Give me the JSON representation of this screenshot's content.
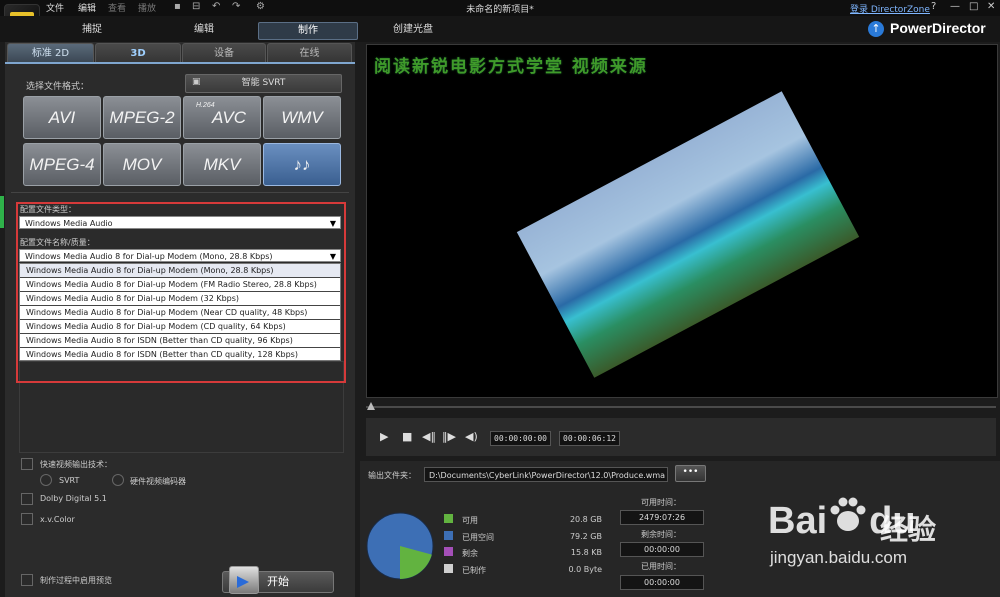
{
  "menu": {
    "file": "文件",
    "edit": "编辑",
    "view": "查看",
    "play": "播放"
  },
  "window": {
    "title": "未命名的新项目*",
    "login": "登录 DirectorZone",
    "help": "?",
    "minimize": "—",
    "maximize": "□",
    "close": "✕"
  },
  "modes": {
    "capture": "捕捉",
    "edit": "编辑",
    "produce": "制作",
    "disc": "创建光盘"
  },
  "brand": "PowerDirector",
  "subtabs": {
    "std2d": "标准 2D",
    "td3": "3D",
    "device": "设备",
    "online": "在线"
  },
  "format": {
    "label": "选择文件格式：",
    "svrt": "智能 SVRT",
    "buttons": [
      "AVI",
      "MPEG-2",
      "AVC",
      "WMV",
      "MPEG-4",
      "MOV",
      "MKV"
    ],
    "avc_sup": "H.264",
    "audio_glyph": "♪♪"
  },
  "profile": {
    "type_label": "配置文件类型：",
    "type_value": "Windows Media Audio",
    "name_label": "配置文件名称/质量：",
    "name_value": "Windows Media Audio 8 for Dial-up Modem (Mono, 28.8 Kbps)",
    "options": [
      "Windows Media Audio 8 for Dial-up Modem (Mono, 28.8 Kbps)",
      "Windows Media Audio 8 for Dial-up Modem (FM Radio Stereo, 28.8 Kbps)",
      "Windows Media Audio 8 for Dial-up Modem (32 Kbps)",
      "Windows Media Audio 8 for Dial-up Modem (Near CD quality, 48 Kbps)",
      "Windows Media Audio 8 for Dial-up Modem (CD quality, 64 Kbps)",
      "Windows Media Audio 8 for ISDN (Better than CD quality, 96 Kbps)",
      "Windows Media Audio 8 for ISDN (Better than CD quality, 128 Kbps)"
    ]
  },
  "options": {
    "fast_video": "快速视频输出技术：",
    "svrt": "SVRT",
    "hw_encoder": "硬件视频编码器",
    "dolby": "Dolby Digital 5.1",
    "xvcolor": "x.v.Color",
    "preview_during": "制作过程中启用预览"
  },
  "start_label": "开始",
  "preview": {
    "overlay_text": "阅读新锐电影方式学堂  视频来源"
  },
  "playback": {
    "current": "00:00:00:00",
    "total": "00:00:06:12"
  },
  "output": {
    "folder_label": "输出文件夹：",
    "path": "D:\\Documents\\CyberLink\\PowerDirector\\12.0\\Produce.wma",
    "browse": "•••"
  },
  "disk": {
    "legend": [
      {
        "label": "可用",
        "value": "20.8  GB",
        "color": "#62b340"
      },
      {
        "label": "已用空间",
        "value": "79.2  GB",
        "color": "#3d6fb5"
      },
      {
        "label": "剩余",
        "value": "15.8  KB",
        "color": "#a44fb8"
      },
      {
        "label": "已制作",
        "value": "0.0  Byte",
        "color": "#cfcfcf"
      }
    ],
    "available_pct": 20.8
  },
  "times": {
    "available_label": "可用时间：",
    "available_value": "2479:07:26",
    "remaining_label": "剩余时间：",
    "remaining_value": "00:00:00",
    "used_label": "已用时间：",
    "used_value": "00:00:00"
  },
  "watermark": {
    "baidu": "Bai",
    "du": "du",
    "jingyan": "经验",
    "url": "jingyan.baidu.com"
  }
}
